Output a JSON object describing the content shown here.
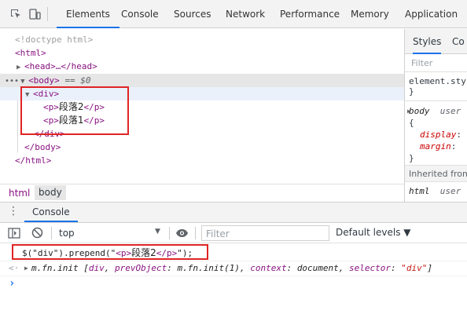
{
  "devtools": {
    "tabs": [
      "Elements",
      "Console",
      "Sources",
      "Network",
      "Performance",
      "Memory",
      "Application"
    ],
    "active_tab": "Elements"
  },
  "dom_tree": {
    "doctype": "<!doctype html>",
    "html_open": "<html>",
    "head_collapsed": "<head>…</head>",
    "body_open": "<body>",
    "body_selected_suffix": "== $0",
    "div_open": "<div>",
    "p1_open": "<p>",
    "p1_text": "段落2",
    "p1_close": "</p>",
    "p2_open": "<p>",
    "p2_text": "段落1",
    "p2_close": "</p>",
    "div_close": "</div>",
    "body_close": "</body>",
    "html_close": "</html>"
  },
  "styles_panel": {
    "tabs": [
      "Styles",
      "Co"
    ],
    "filter_placeholder": "Filter",
    "element_style": "element.sty",
    "close_brace": "}",
    "rule_selector": "body",
    "rule_origin": "user",
    "open_brace": "{",
    "prop1_name": "display",
    "prop2_name": "margin",
    "inherited_label": "Inherited from",
    "inherited_selector": "html",
    "inherited_origin": "user"
  },
  "breadcrumb": [
    "html",
    "body"
  ],
  "drawer": {
    "tab": "Console",
    "context": "top",
    "filter_placeholder": "Filter",
    "levels": "Default levels ▼"
  },
  "console": {
    "input_parts": [
      "$(\"div\").prepend(\"",
      "<p>",
      "段落2",
      "</p>",
      "\");"
    ],
    "result_parts": [
      "m.fn.init [",
      "div",
      ", ",
      "prevObject",
      ": ",
      "m.fn.init(1)",
      ", ",
      "context",
      ": ",
      "document",
      ", ",
      "selector",
      ": ",
      "\"div\"",
      "]"
    ],
    "prompt": "›"
  },
  "colors": {
    "accent": "#1a73e8",
    "tag": "#881280",
    "highlight_box": "#e02424",
    "selected_row": "#e6e6e6",
    "hover_row": "#eaf1fb"
  }
}
